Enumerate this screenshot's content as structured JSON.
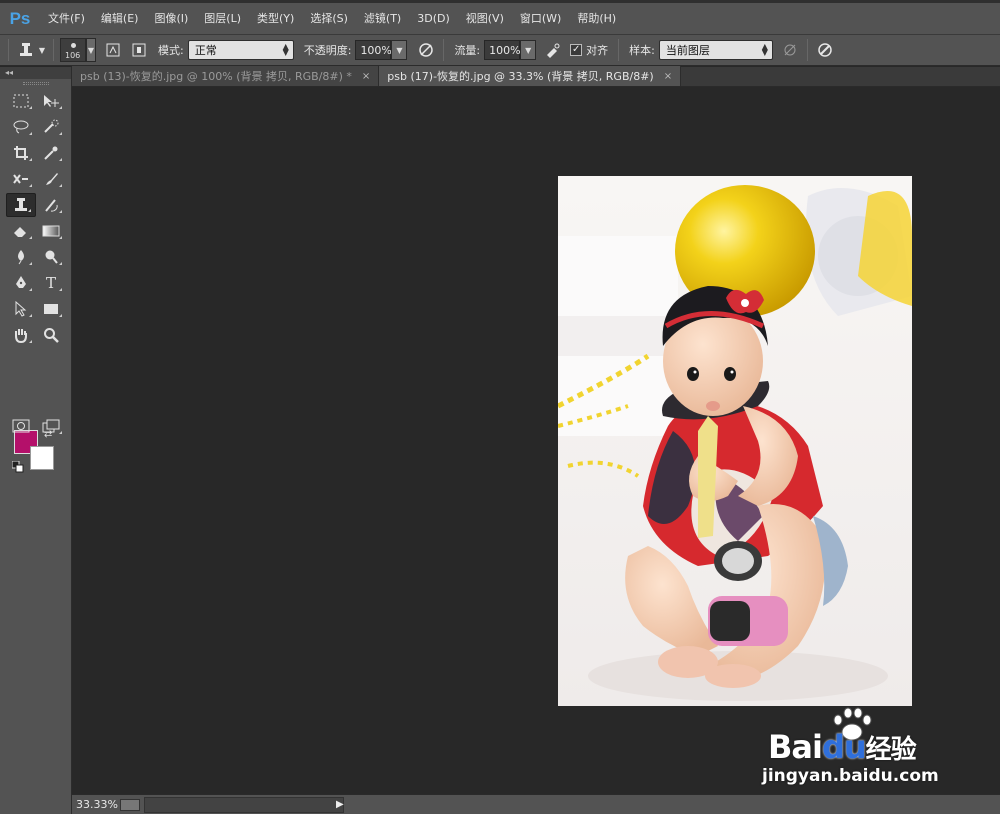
{
  "app": {
    "logo": "Ps"
  },
  "menu": [
    "文件(F)",
    "编辑(E)",
    "图像(I)",
    "图层(L)",
    "类型(Y)",
    "选择(S)",
    "滤镜(T)",
    "3D(D)",
    "视图(V)",
    "窗口(W)",
    "帮助(H)"
  ],
  "options": {
    "brush_size": "106",
    "mode_label": "模式:",
    "mode_value": "正常",
    "opacity_label": "不透明度:",
    "opacity_value": "100%",
    "flow_label": "流量:",
    "flow_value": "100%",
    "align_label": "对齐",
    "align_checked": true,
    "sample_label": "样本:",
    "sample_value": "当前图层"
  },
  "tabs": [
    {
      "label": "psb (13)-恢复的.jpg @ 100% (背景 拷贝, RGB/8#) *",
      "active": false
    },
    {
      "label": "psb (17)-恢复的.jpg @ 33.3% (背景 拷贝, RGB/8#)",
      "active": true
    }
  ],
  "tab_close": "×",
  "tools": {
    "foreground_color": "#b4106a",
    "background_color": "#ffffff"
  },
  "status": {
    "zoom": "33.33%"
  },
  "watermark": {
    "brand": "Bai",
    "brand_cn": "经验",
    "url": "jingyan.baidu.com"
  }
}
